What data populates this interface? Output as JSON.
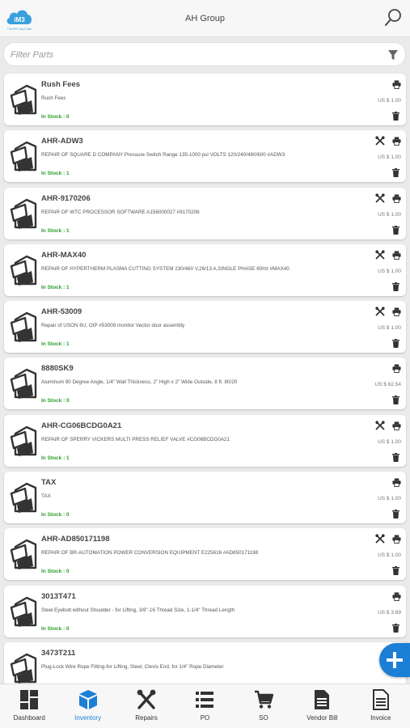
{
  "header": {
    "title": "AH Group",
    "logo_text": "iM3",
    "logo_tagline": "The ERP Cloud Suite"
  },
  "filter": {
    "placeholder": "Filter Parts",
    "value": ""
  },
  "colors": {
    "accent": "#1b7fd6",
    "in_stock": "#2a9d2a"
  },
  "parts": [
    {
      "name": "Rush Fees",
      "description": "Rush Fees",
      "stock": "In Stock : 0",
      "price": "US $ 1.00",
      "has_repair": false
    },
    {
      "name": "AHR-ADW3",
      "description": "REPAIR OF SQUARE D COMPANY Pressure Switch Range 135-1000 psi VOLTS 120/240/480/600 #ADW3",
      "stock": "In Stock : 1",
      "price": "US $ 1.00",
      "has_repair": true
    },
    {
      "name": "AHR-9170206",
      "description": "REPAIR OF WTC PROCESSOR SOFTWARE A156000027 #9170206",
      "stock": "In Stock : 1",
      "price": "US $ 1.00",
      "has_repair": true
    },
    {
      "name": "AHR-MAX40",
      "description": "REPAIR OF HYPERTHERM PLASMA CUTTING SYSTEM 230/460 V,26/13 A,SINGLE PHASE 60Hz #MAX40",
      "stock": "In Stock : 1",
      "price": "US $ 1.00",
      "has_repair": true
    },
    {
      "name": "AHR-53009",
      "description": "Repair of USON 6U, OIP #53009 monitor Vector door assembly",
      "stock": "In Stock : 1",
      "price": "US $ 1.00",
      "has_repair": true
    },
    {
      "name": "8880SK9",
      "description": "Aluminum 90 Degree Angle, 1/4\" Wall Thickness, 2\" High x 2\" Wide Outside, 8 ft. 80/20",
      "stock": "In Stock : 0",
      "price": "US $ 62.54",
      "has_repair": false
    },
    {
      "name": "AHR-CG06BCDG0A21",
      "description": "REPAIR OF SPERRY VICKERS MULTI PRESS RELIEF VALVE #CG06BCDG0A21",
      "stock": "In Stock : 1",
      "price": "US $ 1.00",
      "has_repair": true
    },
    {
      "name": "TAX",
      "description": "TAX",
      "stock": "In Stock : 0",
      "price": "US $ 1.00",
      "has_repair": false
    },
    {
      "name": "AHR-AD850171198",
      "description": "REPAIR OF BR-AUTOMATION POWER CONVERSION EQUIPMENT E225616 #AD850171198",
      "stock": "In Stock : 0",
      "price": "US $ 1.00",
      "has_repair": true
    },
    {
      "name": "3013T471",
      "description": "Steel Eyebolt without Shoulder - for Lifting, 3/8\"-16 Thread Size, 1-1/4\" Thread Length",
      "stock": "In Stock : 0",
      "price": "US $ 3.89",
      "has_repair": false
    },
    {
      "name": "3473T211",
      "description": "Plug-Lock Wire Rope Fitting-for Lifting, Steel, Clevis End, for 1/4\" Rope Diameter",
      "stock": "",
      "price": "",
      "has_repair": false
    }
  ],
  "nav": [
    {
      "label": "Dashboard",
      "icon": "dashboard-icon",
      "active": false
    },
    {
      "label": "Inventory",
      "icon": "inventory-box-icon",
      "active": true
    },
    {
      "label": "Repairs",
      "icon": "repairs-tools-icon",
      "active": false
    },
    {
      "label": "PO",
      "icon": "po-list-icon",
      "active": false
    },
    {
      "label": "SO",
      "icon": "so-cart-icon",
      "active": false
    },
    {
      "label": "Vendor Bill",
      "icon": "vendor-bill-icon",
      "active": false
    },
    {
      "label": "Invoice",
      "icon": "invoice-icon",
      "active": false
    }
  ]
}
